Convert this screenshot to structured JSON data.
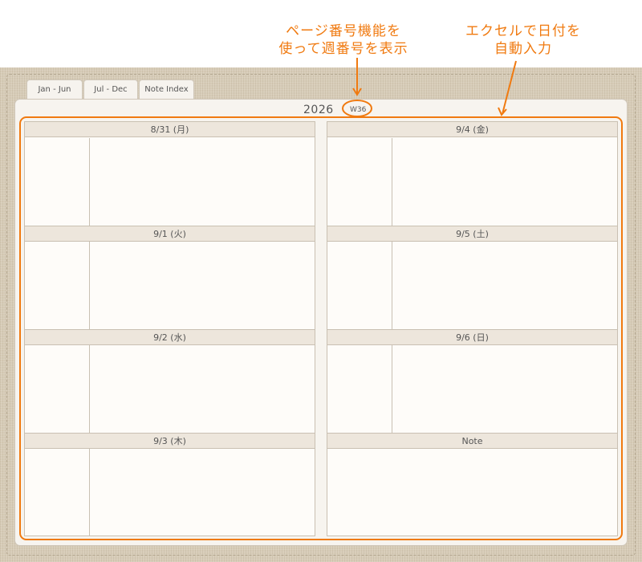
{
  "annotations": {
    "left_line1": "ページ番号機能を",
    "left_line2": "使って週番号を表示",
    "right_line1": "エクセルで日付を",
    "right_line2": "自動入力"
  },
  "tabs": [
    {
      "label": "Jan - Jun"
    },
    {
      "label": "Jul - Dec"
    },
    {
      "label": "Note Index"
    }
  ],
  "header": {
    "year": "2026",
    "week": "W36"
  },
  "days_left": [
    {
      "label": "8/31 (月)"
    },
    {
      "label": "9/1 (火)"
    },
    {
      "label": "9/2 (水)"
    },
    {
      "label": "9/3 (木)"
    }
  ],
  "days_right": [
    {
      "label": "9/4 (金)"
    },
    {
      "label": "9/5 (土)"
    },
    {
      "label": "9/6 (日)"
    },
    {
      "label": "Note"
    }
  ],
  "colors": {
    "annotation": "#f07a10",
    "linen": "#d7ccb8",
    "header_band": "#ede6dc"
  }
}
